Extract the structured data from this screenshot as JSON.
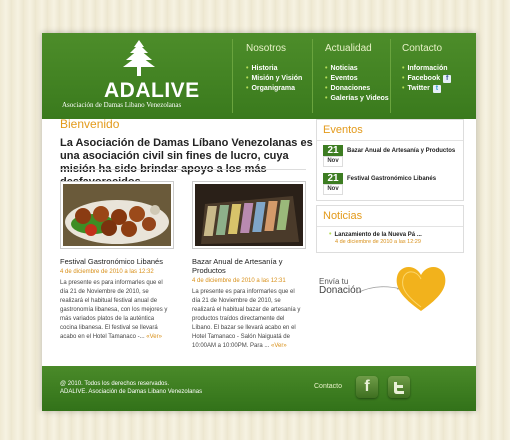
{
  "brand": {
    "name": "ADALIVE",
    "tagline": "Asociación de Damas Libano Venezolanas"
  },
  "nav": [
    {
      "title": "Nosotros",
      "items": [
        "Historia",
        "Misión y Visión",
        "Organigrama"
      ]
    },
    {
      "title": "Actualidad",
      "items": [
        "Noticias",
        "Eventos",
        "Donaciones",
        "Galerías y Videos"
      ]
    },
    {
      "title": "Contacto",
      "items": [
        "Información",
        "Facebook",
        "Twitter"
      ]
    }
  ],
  "welcome": {
    "title": "Bienvenido",
    "text": "La Asociación de Damas Líbano Venezolanas es una asociación civil sin fines de lucro, cuya misión ha sido brindar apoyo a los más desfavorecidos"
  },
  "cards": [
    {
      "title": "Festival Gastronómico Libanés",
      "date": "4 de diciembre de 2010 a las 12:32",
      "text": "La presente es para informarles que el día 21 de Noviembre de 2010, se realizará el habitual festival anual de gastronomía libanesa, con los mejores y más variados platos de la auténtica cocina libanesa. El festival se llevará acabo en el Hotel Tamanaco -... ",
      "more": "«Ver»"
    },
    {
      "title": "Bazar Anual de Artesanía y Productos",
      "date": "4 de diciembre de 2010 a las 12:31",
      "text": "La presente es para informarles que el día 21 de Noviembre de 2010, se realizará el habitual bazar de artesanía y productos traídos directamente del Líbano. El bazar se llevará acabo en el Hotel Tamanaco - Salón Naiguatá de 10:00AM a 10:00PM. Para ... ",
      "more": "«Ver»"
    }
  ],
  "events": {
    "title": "Eventos",
    "items": [
      {
        "day": "21",
        "month": "Nov",
        "title": "Bazar Anual de Artesanía y Productos"
      },
      {
        "day": "21",
        "month": "Nov",
        "title": "Festival Gastronómico Libanés"
      }
    ]
  },
  "news": {
    "title": "Noticias",
    "items": [
      {
        "title": "Lanzamiento de la Nueva Pá ...",
        "date": "4 de diciembre de 2010 a las 12:29"
      }
    ]
  },
  "donation": {
    "line1": "Envía tu",
    "line2": "Donación"
  },
  "footer": {
    "copyright": "@ 2010. Todos los derechos reservados.",
    "org": "ADALIVE. Asociación de Damas Libano Venezolanas",
    "contact_label": "Contacto"
  },
  "colors": {
    "green": "#3d7d22",
    "orange": "#e39a1b"
  }
}
